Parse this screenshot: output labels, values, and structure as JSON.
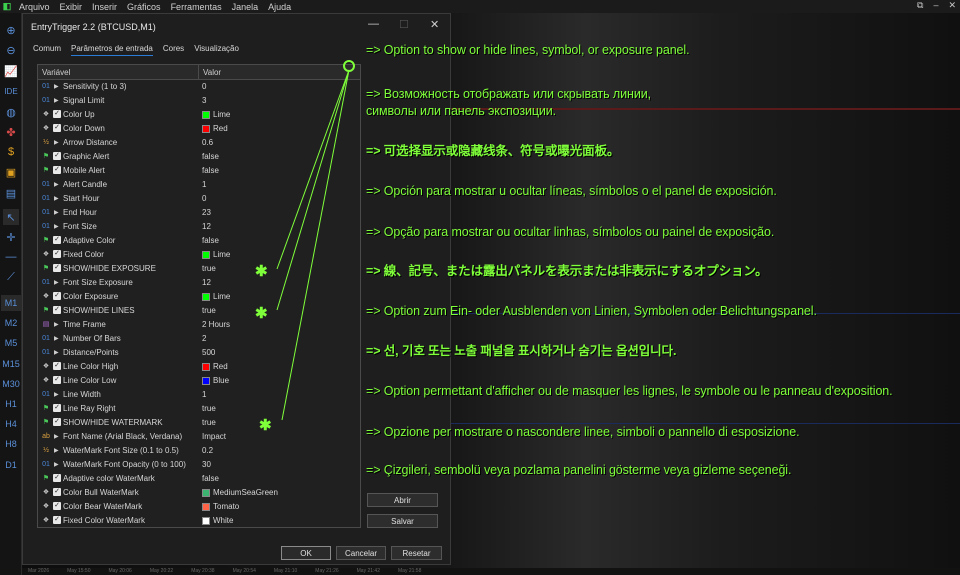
{
  "menu": [
    "Arquivo",
    "Exibir",
    "Inserir",
    "Gráficos",
    "Ferramentas",
    "Janela",
    "Ajuda"
  ],
  "dialog": {
    "title": "EntryTrigger 2.2 (BTCUSD,M1)",
    "tabs": [
      "Comum",
      "Parâmetros de entrada",
      "Cores",
      "Visualização"
    ],
    "active_tab": "Parâmetros de entrada",
    "columns": [
      "Variável",
      "Valor"
    ],
    "rows": [
      {
        "type": "01",
        "label": "Sensitivity (1 to 3)",
        "value": "0"
      },
      {
        "type": "01",
        "label": "Signal Limit",
        "value": "3"
      },
      {
        "type": "color",
        "label": "Color Up",
        "value": "Lime",
        "color": "#00ff00"
      },
      {
        "type": "color",
        "label": "Color Down",
        "value": "Red",
        "color": "#ff0000"
      },
      {
        "type": "half",
        "label": "Arrow Distance",
        "value": "0.6"
      },
      {
        "type": "flag",
        "label": "Graphic Alert",
        "value": "false"
      },
      {
        "type": "flag",
        "label": "Mobile Alert",
        "value": "false"
      },
      {
        "type": "01",
        "label": "Alert Candle",
        "value": "1"
      },
      {
        "type": "01",
        "label": "Start Hour",
        "value": "0"
      },
      {
        "type": "01",
        "label": "End Hour",
        "value": "23"
      },
      {
        "type": "01",
        "label": "Font Size",
        "value": "12"
      },
      {
        "type": "flag",
        "label": "Adaptive Color",
        "value": "false"
      },
      {
        "type": "color",
        "label": "Fixed Color",
        "value": "Lime",
        "color": "#00ff00"
      },
      {
        "type": "flag",
        "label": "SHOW/HIDE EXPOSURE",
        "value": "true"
      },
      {
        "type": "01",
        "label": "Font Size Exposure",
        "value": "12"
      },
      {
        "type": "color",
        "label": "Color Exposure",
        "value": "Lime",
        "color": "#00ff00"
      },
      {
        "type": "flag",
        "label": "SHOW/HIDE LINES",
        "value": "true"
      },
      {
        "type": "enum",
        "label": "Time Frame",
        "value": "2 Hours"
      },
      {
        "type": "01",
        "label": "Number Of Bars",
        "value": "2"
      },
      {
        "type": "01",
        "label": "Distance/Points",
        "value": "500"
      },
      {
        "type": "color",
        "label": "Line Color High",
        "value": "Red",
        "color": "#ff0000"
      },
      {
        "type": "color",
        "label": "Line Color Low",
        "value": "Blue",
        "color": "#0000ff"
      },
      {
        "type": "01",
        "label": "Line  Width",
        "value": "1"
      },
      {
        "type": "flag",
        "label": "Line Ray Right",
        "value": "true"
      },
      {
        "type": "flag",
        "label": "SHOW/HIDE WATERMARK",
        "value": "true"
      },
      {
        "type": "ab",
        "label": "Font Name (Arial Black, Verdana)",
        "value": "Impact"
      },
      {
        "type": "half",
        "label": "WaterMark Font Size (0.1 to 0.5)",
        "value": "0.2"
      },
      {
        "type": "01",
        "label": "WaterMark Font Opacity (0 to 100)",
        "value": "30"
      },
      {
        "type": "flag",
        "label": "Adaptive color WaterMark",
        "value": "false"
      },
      {
        "type": "color",
        "label": "Color Bull WaterMark",
        "value": "MediumSeaGreen",
        "color": "#3cb371"
      },
      {
        "type": "color",
        "label": "Color Bear WaterMark",
        "value": "Tomato",
        "color": "#ff6347"
      },
      {
        "type": "color",
        "label": "Fixed Color WaterMark",
        "value": "White",
        "color": "#ffffff"
      }
    ],
    "buttons": {
      "load": "Abrir",
      "save": "Salvar",
      "ok": "OK",
      "cancel": "Cancelar",
      "reset": "Resetar"
    }
  },
  "timeframes": [
    "M1",
    "M2",
    "M5",
    "M15",
    "M30",
    "H1",
    "H4",
    "H8",
    "D1"
  ],
  "time_labels": [
    "Mar 2026",
    "May 15:50",
    "May 20:06",
    "May 20:22",
    "May 20:38",
    "May 20:54",
    "May 21:10",
    "May 21:26",
    "May 21:42",
    "May 21:58"
  ],
  "annotations": [
    {
      "text": "=> Option to show or hide lines, symbol, or exposure panel.",
      "bold": false
    },
    {
      "text": "=> Возможность отображать или скрывать линии,\nсимволы или панель экспозиции.",
      "bold": false
    },
    {
      "text": "=> 可选择显示或隐藏线条、符号或曝光面板。",
      "bold": true
    },
    {
      "text": "=> Opción para mostrar u ocultar líneas, símbolos o el panel de exposición.",
      "bold": false
    },
    {
      "text": "=> Opção para mostrar ou ocultar linhas, símbolos ou painel de exposição.",
      "bold": false
    },
    {
      "text": "=> 線、記号、または露出パネルを表示または非表示にするオプション。",
      "bold": true
    },
    {
      "text": "=> Option zum Ein- oder Ausblenden von Linien, Symbolen oder Belichtungspanel.",
      "bold": false
    },
    {
      "text": "=> 선, 기호 또는 노출 패널을 표시하거나 숨기는 옵션입니다.",
      "bold": true
    },
    {
      "text": "=> Option permettant d'afficher ou de masquer les lignes, le symbole ou le panneau d'exposition.",
      "bold": false
    },
    {
      "text": "=> Opzione per mostrare o nascondere linee, simboli o pannello di esposizione.",
      "bold": false
    },
    {
      "text": "=> Çizgileri, sembolü veya pozlama panelini gösterme veya gizleme seçeneği.",
      "bold": false
    }
  ],
  "colors": {
    "accent": "#7fff3a",
    "tab_underline": "#2a7ad8",
    "timeframe": "#5a8fd8"
  }
}
